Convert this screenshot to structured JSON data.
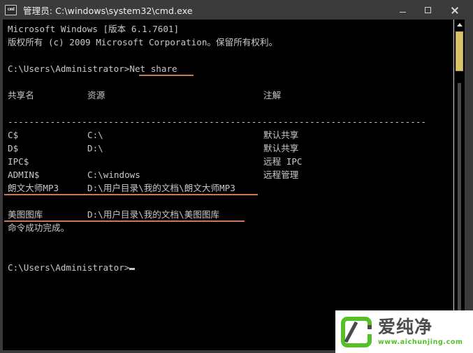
{
  "window": {
    "title": "管理员: C:\\windows\\system32\\cmd.exe",
    "icon_label": "cmd",
    "controls": {
      "minimize": "–",
      "maximize": "□",
      "close": "×"
    },
    "titlebar_color": "#3b3b3b",
    "console_bg": "#000000",
    "console_fg": "#c8c8c8"
  },
  "console": {
    "banner": [
      "Microsoft Windows [版本 6.1.7601]",
      "版权所有 (c) 2009 Microsoft Corporation。保留所有权利。"
    ],
    "prompt_text": "C:\\Users\\Administrator>",
    "command": "Net share",
    "table": {
      "headers": [
        "共享名",
        "资源",
        "注解"
      ],
      "separator": "-------------------------------------------------------------------------------",
      "rows": [
        {
          "share": "C$",
          "resource": "C:\\",
          "remark": "默认共享",
          "highlight": false
        },
        {
          "share": "D$",
          "resource": "D:\\",
          "remark": "默认共享",
          "highlight": false
        },
        {
          "share": "IPC$",
          "resource": "",
          "remark": "远程 IPC",
          "highlight": false
        },
        {
          "share": "ADMIN$",
          "resource": "C:\\windows",
          "remark": "远程管理",
          "highlight": false
        },
        {
          "share": "朗文大师MP3",
          "resource": "D:\\用户目录\\我的文档\\朗文大师MP3",
          "remark": "",
          "highlight": true
        },
        {
          "share": "美图图库",
          "resource": "D:\\用户目录\\我的文档\\美图图库",
          "remark": "",
          "highlight": true
        }
      ]
    },
    "result_message": "命令成功完成。",
    "final_prompt": "C:\\Users\\Administrator>",
    "highlight_color": "#c87a52"
  },
  "scrollbar": {
    "up_arrow": "▲",
    "thumb_color": "#d9c46a",
    "track_color": "#000000"
  },
  "watermark": {
    "brand": "爱纯净",
    "url": "www.aichunjing.com",
    "accent_color": "#55c02a"
  }
}
